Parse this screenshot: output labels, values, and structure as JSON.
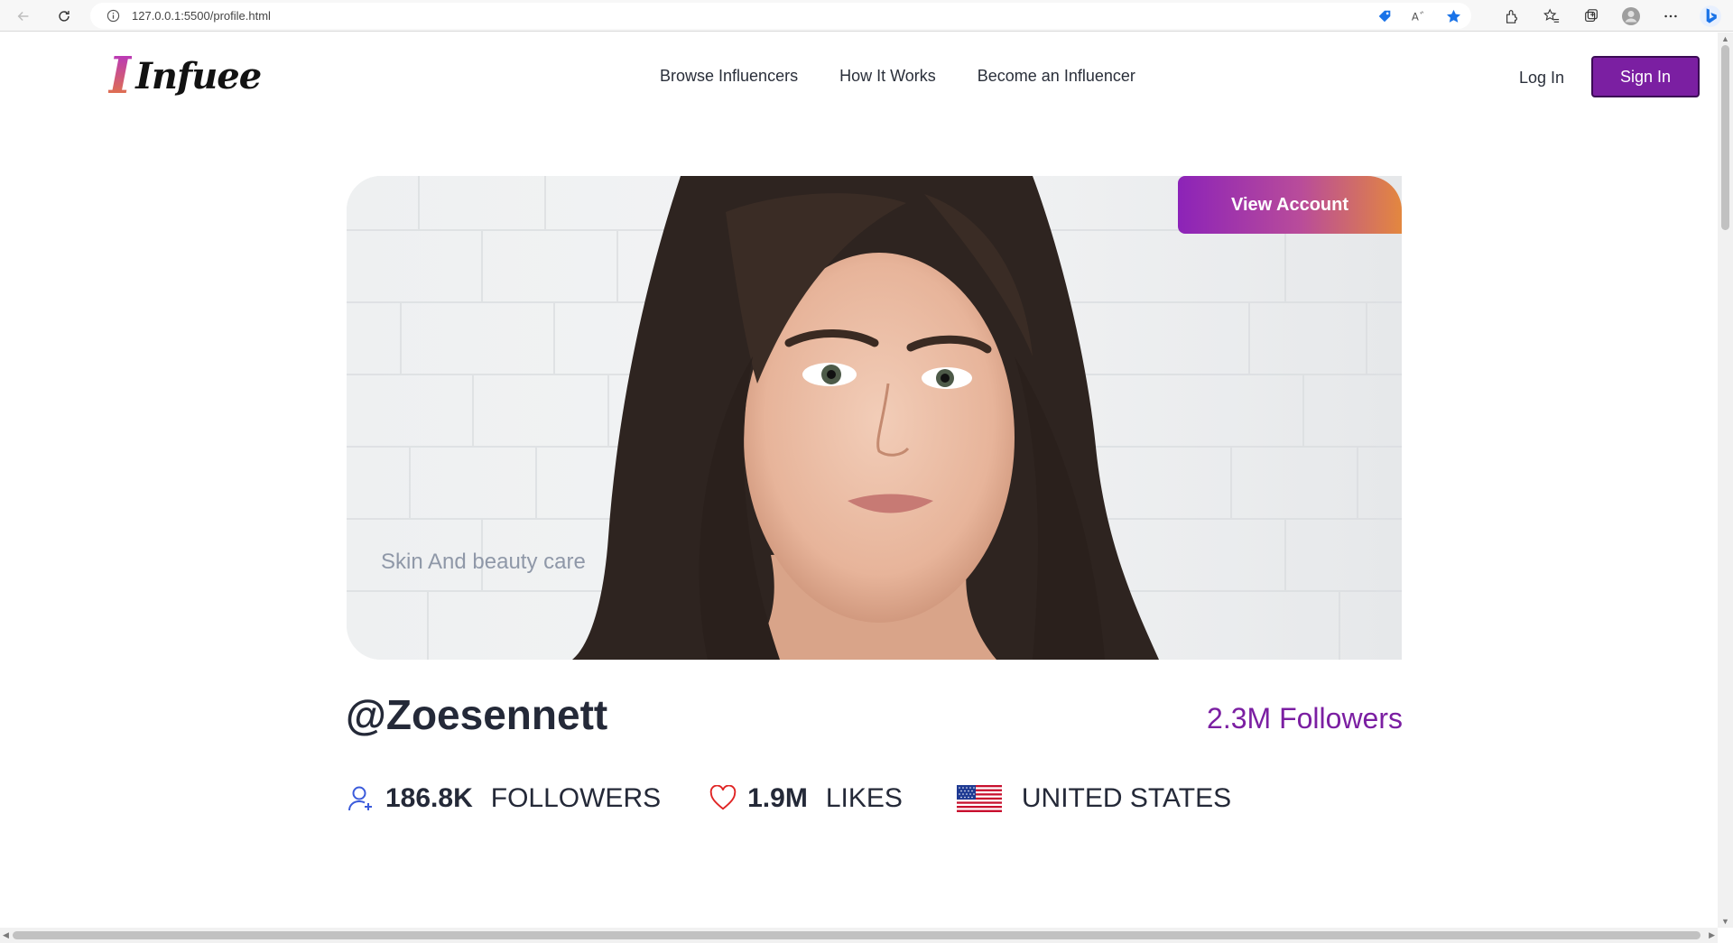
{
  "browser": {
    "url": "127.0.0.1:5500/profile.html",
    "icons": [
      "back-icon",
      "refresh-icon",
      "info-icon",
      "tag-icon",
      "read-aloud-icon",
      "favorite-star-icon",
      "extensions-icon",
      "favorites-icon",
      "collections-icon",
      "profile-icon",
      "more-icon",
      "bing-icon"
    ]
  },
  "header": {
    "logo_mark": "I",
    "logo_text": "Infuee",
    "nav": [
      "Browse Influencers",
      "How It Works",
      "Become an Influencer"
    ],
    "login_label": "Log In",
    "signin_label": "Sign In"
  },
  "hero": {
    "view_account_label": "View Account",
    "category": "Skin And beauty care"
  },
  "profile": {
    "username": "@Zoesennett",
    "followers_total": "2.3M Followers",
    "stats": {
      "followers_value": "186.8K",
      "followers_label": "FOLLOWERS",
      "likes_value": "1.9M",
      "likes_label": "LIKES",
      "country": "UNITED STATES"
    }
  },
  "colors": {
    "brand_purple": "#7b1fa2",
    "gradient_end": "#e3873f",
    "text_dark": "#242938",
    "heart_red": "#e02424",
    "user_icon_blue": "#3b5bdb"
  }
}
